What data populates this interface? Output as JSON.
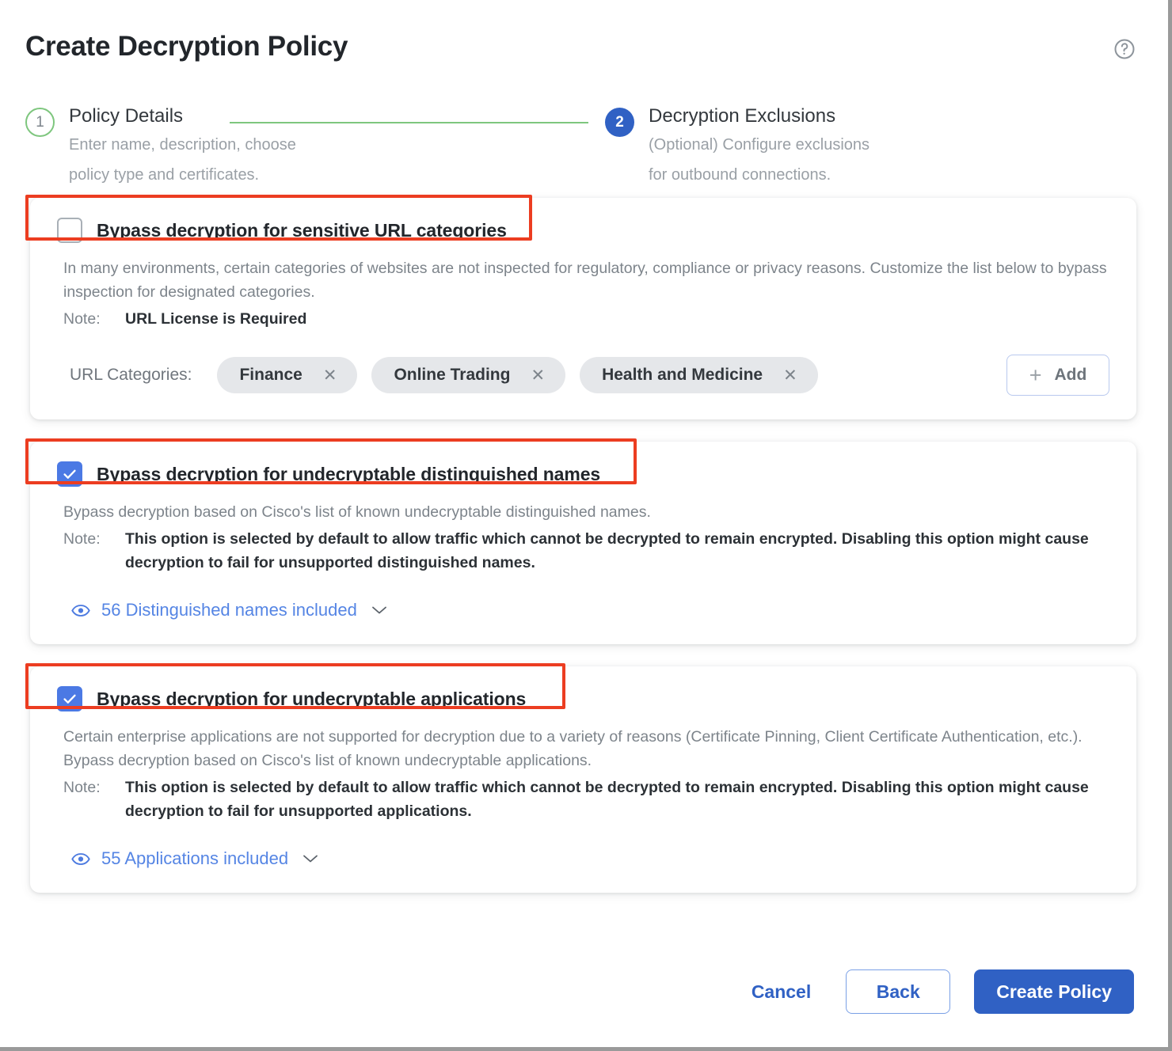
{
  "header": {
    "title": "Create Decryption Policy",
    "help_icon": "help-circle-icon"
  },
  "stepper": {
    "steps": [
      {
        "number": "1",
        "label": "Policy Details",
        "description_line1": "Enter name, description, choose",
        "description_line2": "policy type and certificates.",
        "state": "completed"
      },
      {
        "number": "2",
        "label": "Decryption Exclusions",
        "description_line1": "(Optional) Configure exclusions",
        "description_line2": "for outbound connections.",
        "state": "active"
      }
    ],
    "completed_color": "#7ec67e",
    "active_color": "#3061c4"
  },
  "cards": [
    {
      "checkbox_checked": false,
      "title": "Bypass decryption for sensitive URL categories",
      "body": "In many environments, certain categories of websites are not inspected for regulatory, compliance or privacy reasons. Customize the list below to bypass inspection for designated categories.",
      "note_label": "Note:",
      "note_text": "URL License is Required",
      "categories_label": "URL Categories:",
      "categories": [
        "Finance",
        "Online Trading",
        "Health and Medicine"
      ],
      "add_button": "Add",
      "highlighted": true
    },
    {
      "checkbox_checked": true,
      "title": "Bypass decryption for undecryptable distinguished names",
      "body": "Bypass decryption based on Cisco's list of known undecryptable distinguished names.",
      "note_label": "Note:",
      "note_text": "This option is selected by default to allow traffic which cannot be decrypted to remain encrypted. Disabling this option might cause decryption to fail for unsupported distinguished names.",
      "link_text": "56 Distinguished names included",
      "highlighted": true
    },
    {
      "checkbox_checked": true,
      "title": "Bypass decryption for undecryptable applications",
      "body": "Certain enterprise applications are not supported for decryption due to a variety of reasons (Certificate Pinning, Client Certificate Authentication, etc.). Bypass decryption based on Cisco's list of known undecryptable applications.",
      "note_label": "Note:",
      "note_text": "This option is selected by default to allow traffic which cannot be decrypted to remain encrypted. Disabling this option might cause decryption to fail for unsupported applications.",
      "link_text": "55 Applications included",
      "highlighted": true
    }
  ],
  "footer": {
    "cancel": "Cancel",
    "back": "Back",
    "create": "Create Policy"
  },
  "colors": {
    "annotation": "#ec3d21",
    "primary": "#3061c4",
    "link": "#5585e4",
    "checkbox_checked": "#4b79e4",
    "chip_bg": "#e5e7ea"
  }
}
